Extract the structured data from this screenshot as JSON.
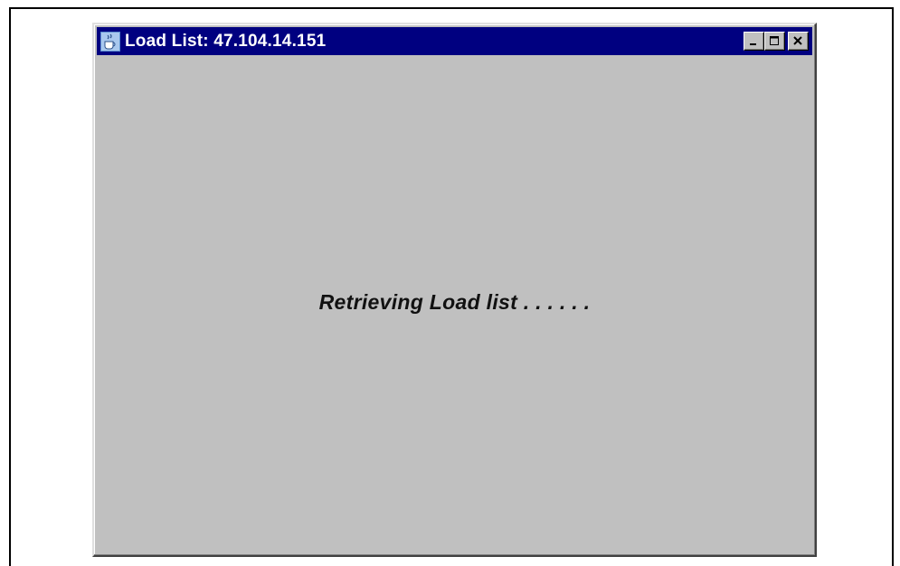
{
  "window": {
    "title": "Load List: 47.104.14.151",
    "app_icon": "java-cup-icon",
    "buttons": {
      "minimize": "minimize-icon",
      "maximize": "maximize-icon",
      "close": "close-icon"
    }
  },
  "content": {
    "status_message": "Retrieving Load list . . . . . ."
  },
  "colors": {
    "titlebar": "#000080",
    "window_bg": "#c0c0c0",
    "title_text": "#ffffff"
  }
}
